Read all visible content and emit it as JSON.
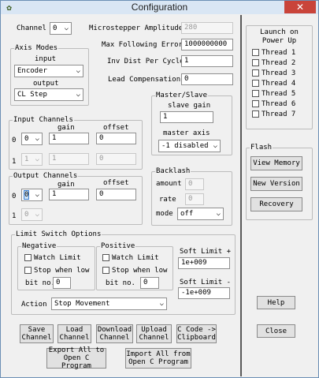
{
  "window": {
    "title": "Configuration",
    "close_glyph": "✕",
    "icon": "dragon-app-icon"
  },
  "channel": {
    "label": "Channel",
    "value": "0"
  },
  "microstepper": {
    "label": "Microstepper Amplitude",
    "value": "280"
  },
  "max_following_error": {
    "label": "Max Following Error",
    "value": "1000000000"
  },
  "inv_dist": {
    "label": "Inv Dist Per Cycle",
    "value": "1"
  },
  "lead_comp": {
    "label": "Lead Compensation",
    "value": "0"
  },
  "axis_modes": {
    "title": "Axis Modes",
    "input_label": "input",
    "input_value": "Encoder",
    "output_label": "output",
    "output_value": "CL Step"
  },
  "master_slave": {
    "title": "Master/Slave",
    "slave_gain_label": "slave gain",
    "slave_gain_value": "1",
    "master_axis_label": "master axis",
    "master_axis_value": "-1 disabled"
  },
  "input_channels": {
    "title": "Input Channels",
    "gain_label": "gain",
    "offset_label": "offset",
    "rows": [
      {
        "index": "0",
        "channel": "0",
        "gain": "1",
        "offset": "0"
      },
      {
        "index": "1",
        "channel": "1",
        "gain": "1",
        "offset": "0"
      }
    ]
  },
  "output_channels": {
    "title": "Output Channels",
    "gain_label": "gain",
    "offset_label": "offset",
    "rows": [
      {
        "index": "0",
        "channel": "0",
        "gain": "1",
        "offset": "0"
      },
      {
        "index": "1",
        "channel": "0"
      }
    ]
  },
  "backlash": {
    "title": "Backlash",
    "amount_label": "amount",
    "amount_value": "0",
    "rate_label": "rate",
    "rate_value": "0",
    "mode_label": "mode",
    "mode_value": "off"
  },
  "limit_switch": {
    "title": "Limit Switch Options",
    "negative": {
      "title": "Negative",
      "watch_label": "Watch Limit",
      "stop_label": "Stop when low",
      "bit_label": "bit no.",
      "bit_value": "0"
    },
    "positive": {
      "title": "Positive",
      "watch_label": "Watch Limit",
      "stop_label": "Stop when low",
      "bit_label": "bit no.",
      "bit_value": "0"
    },
    "soft_plus_label": "Soft Limit +",
    "soft_plus_value": "1e+009",
    "soft_minus_label": "Soft Limit -",
    "soft_minus_value": "-1e+009",
    "action_label": "Action",
    "action_value": "Stop Movement"
  },
  "buttons": {
    "save": [
      "Save",
      "Channel"
    ],
    "load": [
      "Load",
      "Channel"
    ],
    "download": [
      "Download",
      "Channel"
    ],
    "upload": [
      "Upload",
      "Channel"
    ],
    "ccode": [
      "C Code ->",
      "Clipboard"
    ],
    "export": [
      "Export All to",
      "Open C Program"
    ],
    "import": [
      "Import All from",
      "Open C Program"
    ],
    "help": "Help",
    "close": "Close"
  },
  "launch": {
    "title_line1": "Launch on",
    "title_line2": "Power Up",
    "threads": [
      "Thread 1",
      "Thread 2",
      "Thread 3",
      "Thread 4",
      "Thread 5",
      "Thread 6",
      "Thread 7"
    ]
  },
  "flash": {
    "title": "Flash",
    "memory": "View Memory",
    "version": "New Version",
    "recovery": "Recovery"
  },
  "colors": {
    "title_bar": "#d9e6f4",
    "close": "#c9443a",
    "divider": "#5a5a5a",
    "focus": "#3c7fd1"
  }
}
